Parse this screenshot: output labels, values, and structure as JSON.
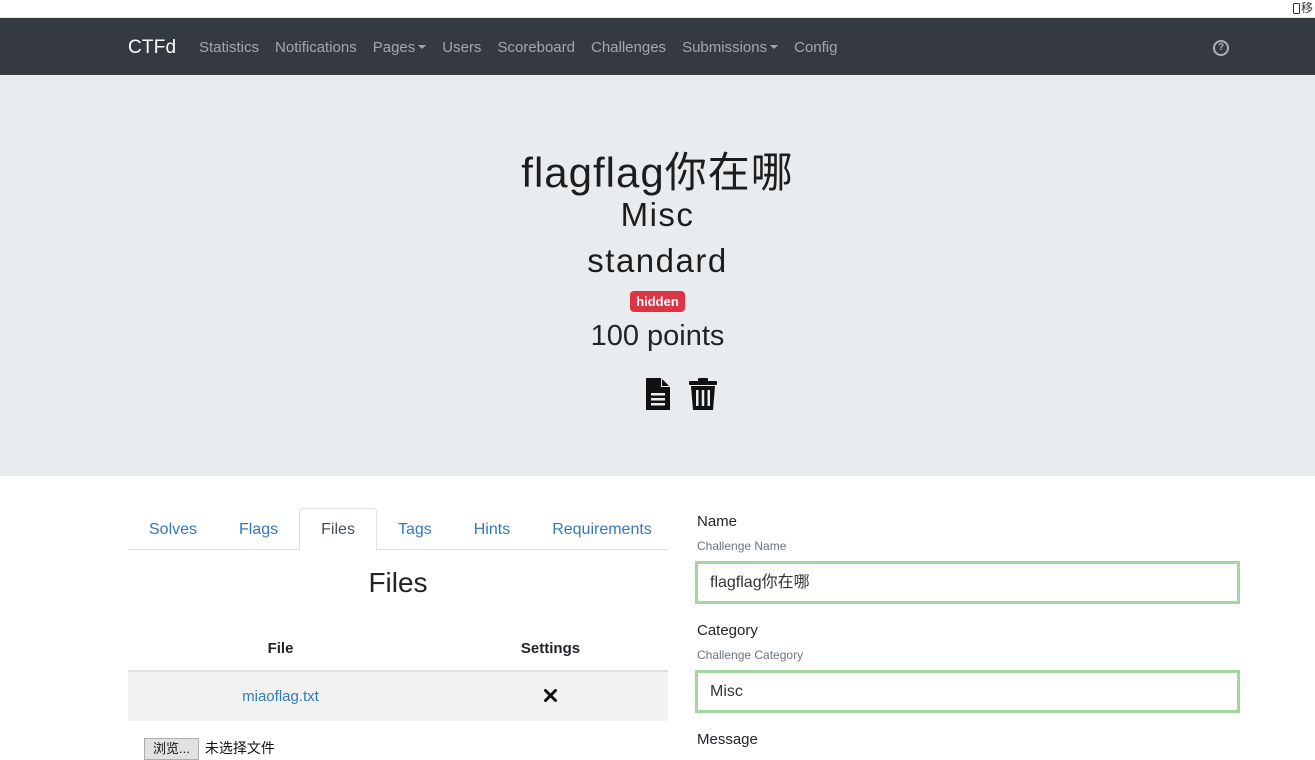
{
  "browser": {
    "mobile_label": "移"
  },
  "navbar": {
    "brand": "CTFd",
    "links": [
      {
        "label": "Statistics",
        "dropdown": false
      },
      {
        "label": "Notifications",
        "dropdown": false
      },
      {
        "label": "Pages",
        "dropdown": true
      },
      {
        "label": "Users",
        "dropdown": false
      },
      {
        "label": "Scoreboard",
        "dropdown": false
      },
      {
        "label": "Challenges",
        "dropdown": false
      },
      {
        "label": "Submissions",
        "dropdown": true
      },
      {
        "label": "Config",
        "dropdown": false
      }
    ],
    "help_icon": "question-circle-icon",
    "help_glyph": "?"
  },
  "challenge": {
    "title": "flagflag你在哪",
    "category": "Misc",
    "type": "standard",
    "state_badge": "hidden",
    "points": "100 points",
    "actions": [
      "file-alt-icon",
      "trash-icon"
    ]
  },
  "tabs": {
    "items": [
      "Solves",
      "Flags",
      "Files",
      "Tags",
      "Hints",
      "Requirements"
    ],
    "active": "Files"
  },
  "files_panel": {
    "heading": "Files",
    "columns": [
      "File",
      "Settings"
    ],
    "rows": [
      {
        "file": "miaoflag.txt",
        "action_icon": "times-icon"
      }
    ],
    "upload": {
      "button": "浏览...",
      "text": "未选择文件"
    }
  },
  "form": {
    "name": {
      "label": "Name",
      "help": "Challenge Name",
      "value": "flagflag你在哪"
    },
    "category": {
      "label": "Category",
      "help": "Challenge Category",
      "value": "Misc"
    },
    "message": {
      "label": "Message"
    }
  },
  "colors": {
    "navbar_bg": "#343a40",
    "jumbotron_bg": "#e9ecef",
    "badge_danger": "#dc3545",
    "link": "#337ab7",
    "input_valid_border": "#a2d8a0"
  }
}
